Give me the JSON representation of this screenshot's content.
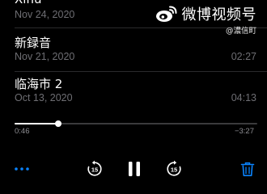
{
  "recordings": [
    {
      "title": "Xinu",
      "date": "Nov 24, 2020",
      "duration": ""
    },
    {
      "title": "新録音",
      "date": "Nov 21, 2020",
      "duration": "02:27"
    },
    {
      "title": "临海市 2",
      "date": "Oct 13, 2020",
      "duration": "04:13"
    }
  ],
  "player": {
    "elapsed": "0:46",
    "remaining": "−3:27",
    "progress": 0.18,
    "skip_back_seconds": "15",
    "skip_forward_seconds": "15",
    "state": "playing"
  },
  "controls": {
    "more_icon": "ellipsis-icon",
    "skip_back_icon": "skip-back-15-icon",
    "pause_icon": "pause-icon",
    "skip_forward_icon": "skip-forward-15-icon",
    "delete_icon": "trash-icon"
  },
  "watermark": {
    "text": "微博视频号",
    "handle": "@濃信町"
  },
  "colors": {
    "background": "#000000",
    "accent": "#0a84ff",
    "secondary_text": "#6e6e73"
  }
}
